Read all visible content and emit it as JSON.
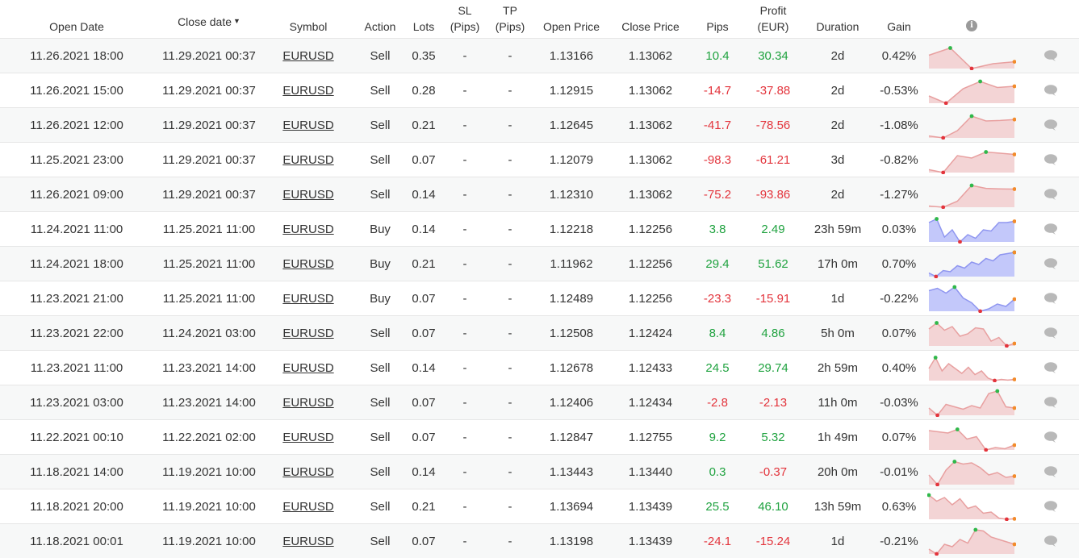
{
  "headers": {
    "open_date": "Open Date",
    "close_date": "Close date",
    "sort_arrow": "▼",
    "symbol": "Symbol",
    "action": "Action",
    "lots": "Lots",
    "sl_line1": "SL",
    "sl_line2": "(Pips)",
    "tp_line1": "TP",
    "tp_line2": "(Pips)",
    "open_price": "Open Price",
    "close_price": "Close Price",
    "pips": "Pips",
    "profit_line1": "Profit",
    "profit_line2": "(EUR)",
    "duration": "Duration",
    "gain": "Gain",
    "info_glyph": "i"
  },
  "colors": {
    "positive": "#1fa23f",
    "negative": "#e3343c",
    "sell_spark": "#e8a0a0",
    "buy_spark": "#8f96f0"
  },
  "icons": {
    "info": "info-icon",
    "comment": "comment-icon"
  },
  "rows": [
    {
      "open": "11.26.2021 18:00",
      "close": "11.29.2021 00:37",
      "symbol": "EURUSD",
      "action": "Sell",
      "lots": "0.35",
      "sl": "-",
      "tp": "-",
      "open_price": "1.13166",
      "close_price": "1.13062",
      "pips": "10.4",
      "profit": "30.34",
      "duration": "2d",
      "gain": "0.42%",
      "spark": [
        0.55,
        0.85,
        0.0,
        0.2,
        0.28
      ]
    },
    {
      "open": "11.26.2021 15:00",
      "close": "11.29.2021 00:37",
      "symbol": "EURUSD",
      "action": "Sell",
      "lots": "0.28",
      "sl": "-",
      "tp": "-",
      "open_price": "1.12915",
      "close_price": "1.13062",
      "pips": "-14.7",
      "profit": "-37.88",
      "duration": "2d",
      "gain": "-0.53%",
      "spark": [
        0.3,
        0.0,
        0.6,
        0.9,
        0.65,
        0.7
      ]
    },
    {
      "open": "11.26.2021 12:00",
      "close": "11.29.2021 00:37",
      "symbol": "EURUSD",
      "action": "Sell",
      "lots": "0.21",
      "sl": "-",
      "tp": "-",
      "open_price": "1.12645",
      "close_price": "1.13062",
      "pips": "-41.7",
      "profit": "-78.56",
      "duration": "2d",
      "gain": "-1.08%",
      "spark": [
        0.08,
        0.0,
        0.3,
        0.9,
        0.7,
        0.72,
        0.76
      ]
    },
    {
      "open": "11.25.2021 23:00",
      "close": "11.29.2021 00:37",
      "symbol": "EURUSD",
      "action": "Sell",
      "lots": "0.07",
      "sl": "-",
      "tp": "-",
      "open_price": "1.12079",
      "close_price": "1.13062",
      "pips": "-98.3",
      "profit": "-61.21",
      "duration": "3d",
      "gain": "-0.82%",
      "spark": [
        0.12,
        0.0,
        0.7,
        0.6,
        0.85,
        0.8,
        0.75
      ]
    },
    {
      "open": "11.26.2021 09:00",
      "close": "11.29.2021 00:37",
      "symbol": "EURUSD",
      "action": "Sell",
      "lots": "0.14",
      "sl": "-",
      "tp": "-",
      "open_price": "1.12310",
      "close_price": "1.13062",
      "pips": "-75.2",
      "profit": "-93.86",
      "duration": "2d",
      "gain": "-1.27%",
      "spark": [
        0.05,
        0.0,
        0.25,
        0.9,
        0.78,
        0.76,
        0.75
      ]
    },
    {
      "open": "11.24.2021 11:00",
      "close": "11.25.2021 11:00",
      "symbol": "EURUSD",
      "action": "Buy",
      "lots": "0.14",
      "sl": "-",
      "tp": "-",
      "open_price": "1.12218",
      "close_price": "1.12256",
      "pips": "3.8",
      "profit": "2.49",
      "duration": "23h 59m",
      "gain": "0.03%",
      "spark": [
        0.8,
        0.95,
        0.2,
        0.5,
        0.0,
        0.3,
        0.15,
        0.5,
        0.45,
        0.8,
        0.8,
        0.85
      ]
    },
    {
      "open": "11.24.2021 18:00",
      "close": "11.25.2021 11:00",
      "symbol": "EURUSD",
      "action": "Buy",
      "lots": "0.21",
      "sl": "-",
      "tp": "-",
      "open_price": "1.11962",
      "close_price": "1.12256",
      "pips": "29.4",
      "profit": "51.62",
      "duration": "17h 0m",
      "gain": "0.70%",
      "spark": [
        0.15,
        0.0,
        0.25,
        0.2,
        0.45,
        0.35,
        0.6,
        0.5,
        0.75,
        0.65,
        0.9,
        0.95,
        1.0
      ]
    },
    {
      "open": "11.23.2021 21:00",
      "close": "11.25.2021 11:00",
      "symbol": "EURUSD",
      "action": "Buy",
      "lots": "0.07",
      "sl": "-",
      "tp": "-",
      "open_price": "1.12489",
      "close_price": "1.12256",
      "pips": "-23.3",
      "profit": "-15.91",
      "duration": "1d",
      "gain": "-0.22%",
      "spark": [
        0.85,
        0.95,
        0.75,
        1.0,
        0.55,
        0.35,
        0.0,
        0.1,
        0.3,
        0.2,
        0.5
      ]
    },
    {
      "open": "11.23.2021 22:00",
      "close": "11.24.2021 03:00",
      "symbol": "EURUSD",
      "action": "Sell",
      "lots": "0.07",
      "sl": "-",
      "tp": "-",
      "open_price": "1.12508",
      "close_price": "1.12424",
      "pips": "8.4",
      "profit": "4.86",
      "duration": "5h 0m",
      "gain": "0.07%",
      "spark": [
        0.7,
        0.95,
        0.65,
        0.8,
        0.4,
        0.5,
        0.75,
        0.7,
        0.2,
        0.35,
        0.0,
        0.1
      ]
    },
    {
      "open": "11.23.2021 11:00",
      "close": "11.23.2021 14:00",
      "symbol": "EURUSD",
      "action": "Sell",
      "lots": "0.14",
      "sl": "-",
      "tp": "-",
      "open_price": "1.12678",
      "close_price": "1.12433",
      "pips": "24.5",
      "profit": "29.74",
      "duration": "2h 59m",
      "gain": "0.40%",
      "spark": [
        0.5,
        0.95,
        0.4,
        0.7,
        0.5,
        0.3,
        0.55,
        0.25,
        0.4,
        0.1,
        0.0,
        0.05,
        0.02,
        0.05
      ]
    },
    {
      "open": "11.23.2021 03:00",
      "close": "11.23.2021 14:00",
      "symbol": "EURUSD",
      "action": "Sell",
      "lots": "0.07",
      "sl": "-",
      "tp": "-",
      "open_price": "1.12406",
      "close_price": "1.12434",
      "pips": "-2.8",
      "profit": "-2.13",
      "duration": "11h 0m",
      "gain": "-0.03%",
      "spark": [
        0.3,
        0.0,
        0.45,
        0.35,
        0.25,
        0.4,
        0.3,
        0.9,
        1.0,
        0.35,
        0.3
      ]
    },
    {
      "open": "11.22.2021 00:10",
      "close": "11.22.2021 02:00",
      "symbol": "EURUSD",
      "action": "Sell",
      "lots": "0.07",
      "sl": "-",
      "tp": "-",
      "open_price": "1.12847",
      "close_price": "1.12755",
      "pips": "9.2",
      "profit": "5.32",
      "duration": "1h 49m",
      "gain": "0.07%",
      "spark": [
        0.8,
        0.75,
        0.7,
        0.85,
        0.45,
        0.55,
        0.0,
        0.1,
        0.05,
        0.2
      ]
    },
    {
      "open": "11.18.2021 14:00",
      "close": "11.19.2021 10:00",
      "symbol": "EURUSD",
      "action": "Sell",
      "lots": "0.14",
      "sl": "-",
      "tp": "-",
      "open_price": "1.13443",
      "close_price": "1.13440",
      "pips": "0.3",
      "profit": "-0.37",
      "duration": "20h 0m",
      "gain": "-0.01%",
      "spark": [
        0.4,
        0.0,
        0.6,
        0.95,
        0.85,
        0.9,
        0.7,
        0.4,
        0.5,
        0.3,
        0.35
      ]
    },
    {
      "open": "11.18.2021 20:00",
      "close": "11.19.2021 10:00",
      "symbol": "EURUSD",
      "action": "Sell",
      "lots": "0.21",
      "sl": "-",
      "tp": "-",
      "open_price": "1.13694",
      "close_price": "1.13439",
      "pips": "25.5",
      "profit": "46.10",
      "duration": "13h 59m",
      "gain": "0.63%",
      "spark": [
        1.0,
        0.75,
        0.9,
        0.6,
        0.85,
        0.45,
        0.55,
        0.25,
        0.3,
        0.05,
        0.0,
        0.02
      ]
    },
    {
      "open": "11.18.2021 00:01",
      "close": "11.19.2021 10:00",
      "symbol": "EURUSD",
      "action": "Sell",
      "lots": "0.07",
      "sl": "-",
      "tp": "-",
      "open_price": "1.13198",
      "close_price": "1.13439",
      "pips": "-24.1",
      "profit": "-15.24",
      "duration": "1d",
      "gain": "-0.21%",
      "spark": [
        0.2,
        0.0,
        0.4,
        0.3,
        0.6,
        0.45,
        1.0,
        0.95,
        0.7,
        0.6,
        0.5,
        0.4
      ]
    }
  ]
}
